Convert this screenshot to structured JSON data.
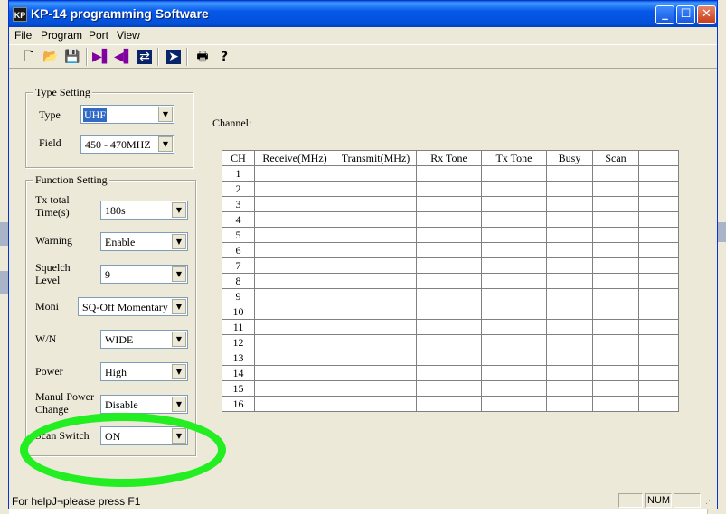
{
  "window": {
    "title": "KP-14 programming Software",
    "icon_text": "KP"
  },
  "menu": [
    "File",
    "Program",
    "Port",
    "View"
  ],
  "toolbar": {
    "buttons": [
      "new-icon",
      "open-icon",
      "save-icon",
      "read-radio-icon",
      "write-radio-icon",
      "clone-icon",
      "auto-icon",
      "print-icon",
      "help-icon"
    ]
  },
  "type_setting": {
    "legend": "Type Setting",
    "type_label": "Type",
    "type_value": "UHF",
    "field_label": "Field",
    "field_value": "450 - 470MHZ"
  },
  "function_setting": {
    "legend": "Function Setting",
    "fields": [
      {
        "label": "Tx total Time(s)",
        "value": "180s"
      },
      {
        "label": "Warning",
        "value": "Enable"
      },
      {
        "label": "Squelch Level",
        "value": "9"
      },
      {
        "label": "Moni",
        "value": "SQ-Off Momentary"
      },
      {
        "label": "W/N",
        "value": "WIDE"
      },
      {
        "label": "Power",
        "value": "High"
      },
      {
        "label": "Manul Power Change",
        "value": "Disable"
      },
      {
        "label": "Scan Switch",
        "value": "ON"
      }
    ]
  },
  "channel": {
    "label": "Channel:",
    "columns": [
      "CH",
      "Receive(MHz)",
      "Transmit(MHz)",
      "Rx Tone",
      "Tx Tone",
      "Busy",
      "Scan",
      ""
    ],
    "rows": [
      "1",
      "2",
      "3",
      "4",
      "5",
      "6",
      "7",
      "8",
      "9",
      "10",
      "11",
      "12",
      "13",
      "14",
      "15",
      "16"
    ]
  },
  "annotation": {
    "color": "#22ee22"
  },
  "status": {
    "help_text": "For helpJ¬please press F1",
    "num": "NUM"
  },
  "colors": {
    "title_bar": "#0558e8",
    "window_bg": "#ece9d8",
    "selection": "#316ac5"
  }
}
